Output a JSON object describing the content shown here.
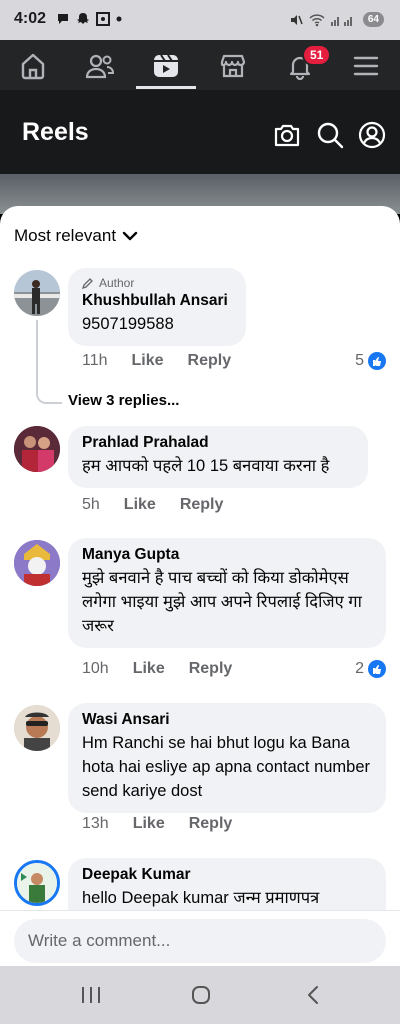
{
  "status_bar": {
    "time": "4:02",
    "battery": "64"
  },
  "nav": {
    "items": [
      "home",
      "friends",
      "reels",
      "marketplace",
      "notifications",
      "menu"
    ],
    "notification_count": "51"
  },
  "header": {
    "title": "Reels"
  },
  "sort": {
    "label": "Most relevant"
  },
  "comments": [
    {
      "name": "Khushbullah Ansari",
      "author_tag": "Author",
      "text": "9507199588",
      "time": "11h",
      "like": "Like",
      "reply": "Reply",
      "reactions": "5",
      "view_replies": "View 3 replies..."
    },
    {
      "name": "Prahlad Prahalad",
      "text": "हम आपको पहले 10 15 बनवाया करना है",
      "time": "5h",
      "like": "Like",
      "reply": "Reply"
    },
    {
      "name": "Manya Gupta",
      "text": "मुझे बनवाने है पाच बच्चों को किया डोकोमेएस लगेगा भाइया मुझे आप अपने रिपलाई दिजिए गा जरूर",
      "time": "10h",
      "like": "Like",
      "reply": "Reply",
      "reactions": "2"
    },
    {
      "name": "Wasi Ansari",
      "text": "Hm Ranchi se hai bhut logu ka Bana hota hai esliye ap apna contact number send kariye dost",
      "time": "13h",
      "like": "Like",
      "reply": "Reply"
    },
    {
      "name": "Deepak Kumar",
      "text": "hello Deepak kumar जन्म प्रमाणपत्र"
    }
  ],
  "composer": {
    "placeholder": "Write a comment..."
  },
  "colors": {
    "accent": "#1877f2",
    "badge": "#e41e3f",
    "header_bg": "#18191a",
    "nav_bg": "#242526"
  }
}
